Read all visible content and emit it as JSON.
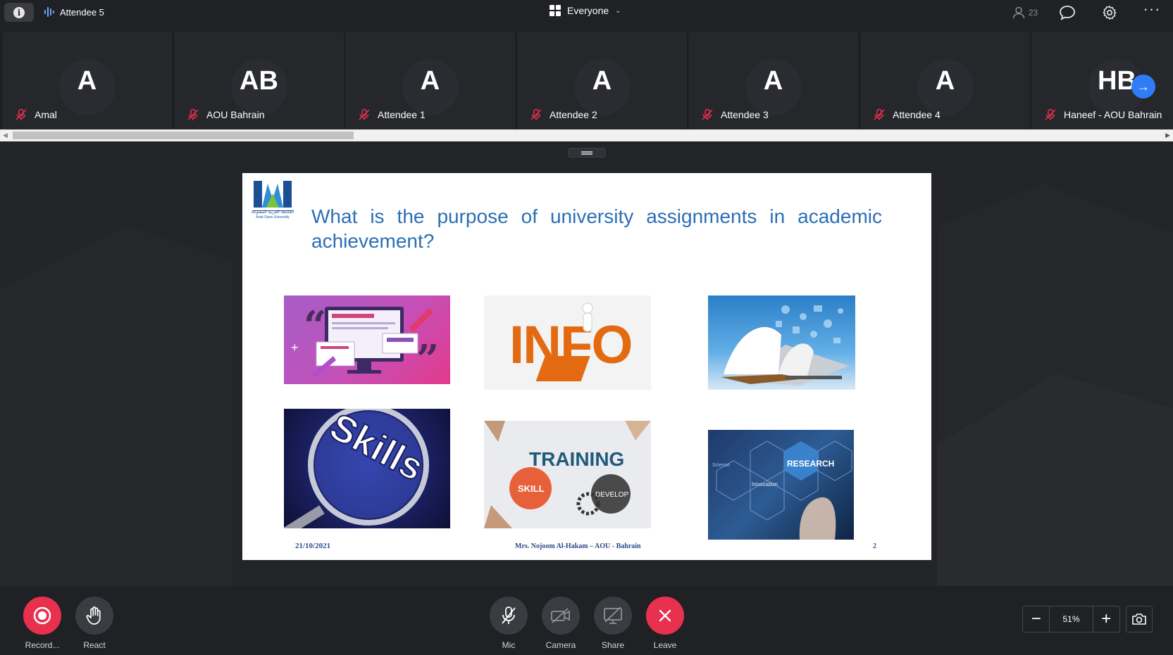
{
  "topbar": {
    "active_speaker": "Attendee 5",
    "view_label": "Everyone",
    "people_count": "23"
  },
  "participants": [
    {
      "initials": "A",
      "name": "Amal"
    },
    {
      "initials": "AB",
      "name": "AOU Bahrain"
    },
    {
      "initials": "A",
      "name": "Attendee 1"
    },
    {
      "initials": "A",
      "name": "Attendee 2"
    },
    {
      "initials": "A",
      "name": "Attendee 3"
    },
    {
      "initials": "A",
      "name": "Attendee 4"
    },
    {
      "initials": "HB",
      "name": "Haneef - AOU Bahrain"
    }
  ],
  "slide": {
    "title": "What is the purpose of university assignments in academic achievement?",
    "date": "21/10/2021",
    "presenter": "Mrs. Nojoom Al-Hakam – AOU - Bahrain",
    "page_number": "2",
    "logo_text": "الجامعة العربية المفتوحة",
    "logo_text_en": "Arab Open University",
    "images": {
      "info": "INFO",
      "skills": "Skills",
      "training": "TRAINING",
      "skill": "SKILL",
      "develop": "DEVELOP",
      "research": "RESEARCH",
      "innovation": "Innovation",
      "science": "Science"
    }
  },
  "controls": {
    "record": "Record...",
    "react": "React",
    "mic": "Mic",
    "camera": "Camera",
    "share": "Share",
    "leave": "Leave"
  },
  "zoom": {
    "value": "51%"
  },
  "colors": {
    "record": "#e8304f",
    "leave": "#e8304f",
    "accent": "#2f7df6",
    "slide_title": "#2b6fb5"
  }
}
